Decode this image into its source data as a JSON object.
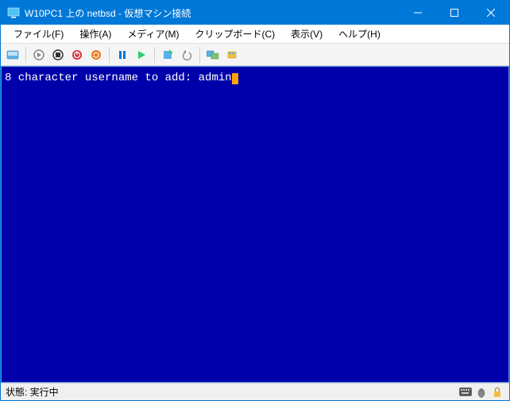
{
  "titlebar": {
    "title": "W10PC1 上の netbsd - 仮想マシン接続"
  },
  "menu": {
    "file": "ファイル(F)",
    "action": "操作(A)",
    "media": "メディア(M)",
    "clipboard": "クリップボード(C)",
    "view": "表示(V)",
    "help": "ヘルプ(H)"
  },
  "console": {
    "prompt": "8 character username to add: ",
    "input": "admin"
  },
  "status": {
    "text": "状態: 実行中"
  },
  "colors": {
    "accent": "#0078d7",
    "console_bg": "#0000aa",
    "cursor": "#ffa500"
  }
}
